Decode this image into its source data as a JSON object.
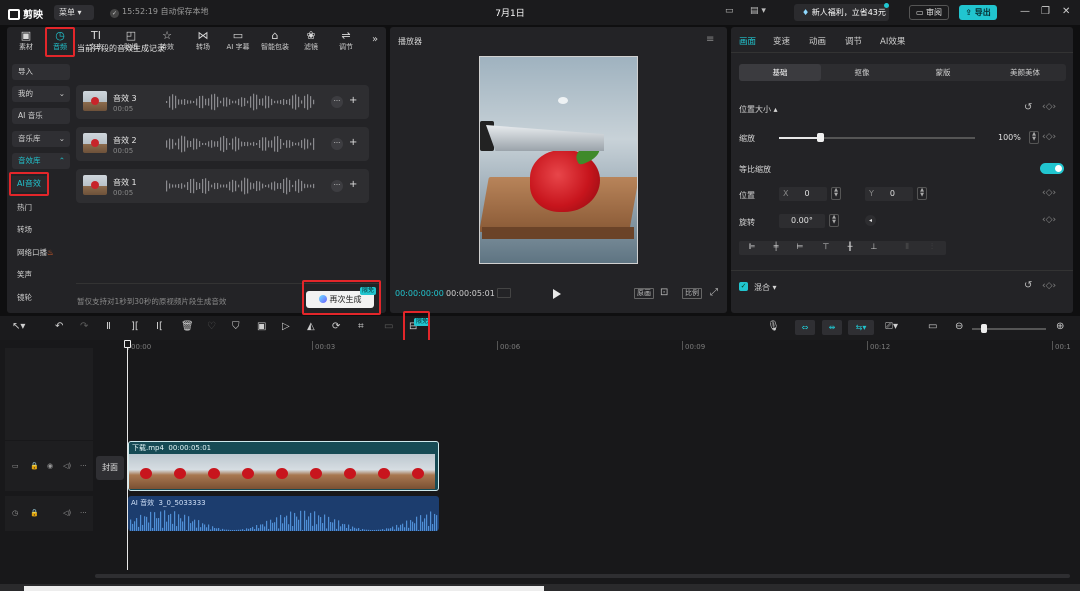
{
  "titlebar": {
    "app_name": "剪映",
    "menu_label": "菜单",
    "save_status": "15:52:19 自动保存本地",
    "doc_title": "7月1日",
    "promo": "新人福利，立省43元",
    "review_label": "审阅",
    "export_label": "导出"
  },
  "toolbar": {
    "tabs": [
      {
        "label": "素材",
        "icon": "media-icon"
      },
      {
        "label": "音频",
        "icon": "audio-icon"
      },
      {
        "label": "文本",
        "icon": "text-icon"
      },
      {
        "label": "贴纸",
        "icon": "sticker-icon"
      },
      {
        "label": "特效",
        "icon": "effects-icon"
      },
      {
        "label": "转场",
        "icon": "transition-icon"
      },
      {
        "label": "AI 字幕",
        "icon": "subtitle-icon"
      },
      {
        "label": "智能包装",
        "icon": "package-icon"
      },
      {
        "label": "滤镜",
        "icon": "filter-icon"
      },
      {
        "label": "调节",
        "icon": "adjust-icon"
      }
    ],
    "active_tab": "音频",
    "accent": "#21c5cf",
    "highlight": "#e3262a"
  },
  "sidebar": {
    "import": "导入",
    "mine": "我的",
    "ai_music": "AI 音乐",
    "music_lib": "音乐库",
    "sfx_lib": "音效库",
    "ai_sfx": "AI音效",
    "hot": "热门",
    "transition": "转场",
    "catchphrase": "网络口播",
    "laugh": "笑声",
    "lens": "镜轮"
  },
  "sfx_panel": {
    "section_title": "当前片段的音效生成记录",
    "records": [
      {
        "name": "音效 3",
        "duration": "00:05"
      },
      {
        "name": "音效 2",
        "duration": "00:05"
      },
      {
        "name": "音效 1",
        "duration": "00:05"
      }
    ],
    "hint": "暂仅支持对1秒到30秒的原视频片段生成音效",
    "regen_label": "再次生成",
    "free_badge": "限免"
  },
  "preview": {
    "title": "播放器",
    "current_time": "00:00:00:00",
    "total_time": "00:00:05:01",
    "controls": [
      "原画",
      "比例"
    ]
  },
  "props": {
    "tabs": [
      "画面",
      "变速",
      "动画",
      "调节",
      "AI效果"
    ],
    "active_tab": "画面",
    "segments": [
      "基础",
      "抠像",
      "蒙版",
      "美颜美体"
    ],
    "active_segment": "基础",
    "position_size": "位置大小",
    "scale_label": "缩放",
    "scale_value": "100%",
    "scale_fraction": 0.21,
    "uniform_scale": "等比缩放",
    "position_label": "位置",
    "x_key": "X",
    "x_value": "0",
    "y_key": "Y",
    "y_value": "0",
    "rotate_label": "旋转",
    "rotate_value": "0.00°",
    "blend_label": "混合"
  },
  "timeline": {
    "ruler": [
      "00:00",
      "00:03",
      "00:06",
      "00:09",
      "00:12",
      "00:1"
    ],
    "cover_label": "封面",
    "video_clip_label": "下载.mp4",
    "video_clip_duration": "00:00:05:01",
    "audio_clip_label": "AI 音效",
    "audio_clip_duration": "3_0_5033333",
    "free_badge": "限免"
  }
}
